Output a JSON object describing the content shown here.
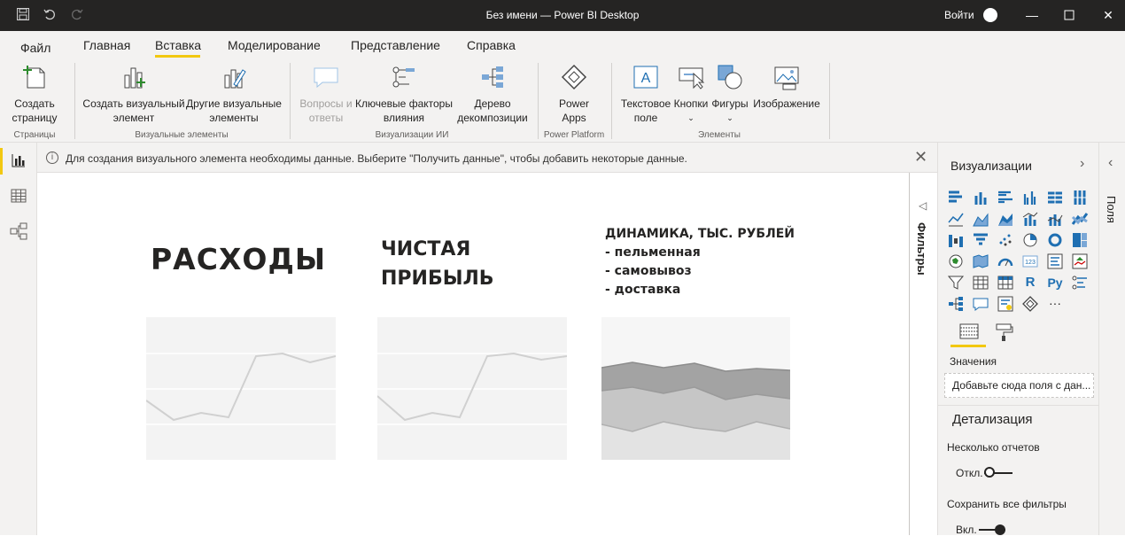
{
  "window": {
    "title": "Без имени — Power BI Desktop",
    "sign_in": "Войти"
  },
  "menu": {
    "tabs": [
      "Файл",
      "Главная",
      "Вставка",
      "Моделирование",
      "Представление",
      "Справка"
    ],
    "active": "Вставка"
  },
  "ribbon": {
    "new_page": "Создать\nстраницу",
    "pages_group": "Страницы",
    "new_visual": "Создать визуальный\nэлемент",
    "other_visuals": "Другие визуальные\nэлементы",
    "visuals_group": "Визуальные элементы",
    "qa": "Вопросы и\nответы",
    "key_influencers": "Ключевые факторы\nвлияния",
    "decomp_tree": "Дерево\nдекомпозиции",
    "ai_group": "Визуализации ИИ",
    "power_apps": "Power\nApps",
    "power_platform_group": "Power Platform",
    "text_box": "Текстовое\nполе",
    "buttons": "Кнопки",
    "shapes": "Фигуры",
    "image": "Изображение",
    "elements_group": "Элементы"
  },
  "info_bar": {
    "text": "Для создания визуального элемента необходимы данные. Выберите \"Получить данные\", чтобы добавить некоторые данные."
  },
  "canvas": {
    "title1": "РАСХОДЫ",
    "title2_line1": "ЧИСТАЯ",
    "title2_line2": "ПРИБЫЛЬ",
    "title3_line1": "ДИНАМИКА, ТЫС. РУБЛЕЙ",
    "title3_line2": "- пельменная",
    "title3_line3": "- самовывоз",
    "title3_line4": "- доставка"
  },
  "filters": {
    "label": "Фильтры"
  },
  "viz": {
    "header": "Визуализации",
    "values_label": "Значения",
    "values_placeholder": "Добавьте сюда поля с дан...",
    "drill_header": "Детализация",
    "multi_reports": "Несколько отчетов",
    "off_label": "Откл.",
    "keep_filters": "Сохранить все фильтры",
    "on_label": "Вкл.",
    "r_label": "R",
    "py_label": "Py",
    "more_label": "···"
  },
  "fields": {
    "label": "Поля"
  },
  "colors": {
    "accent": "#f2c811",
    "titlebar": "#252423",
    "ribbon": "#f3f2f1"
  }
}
